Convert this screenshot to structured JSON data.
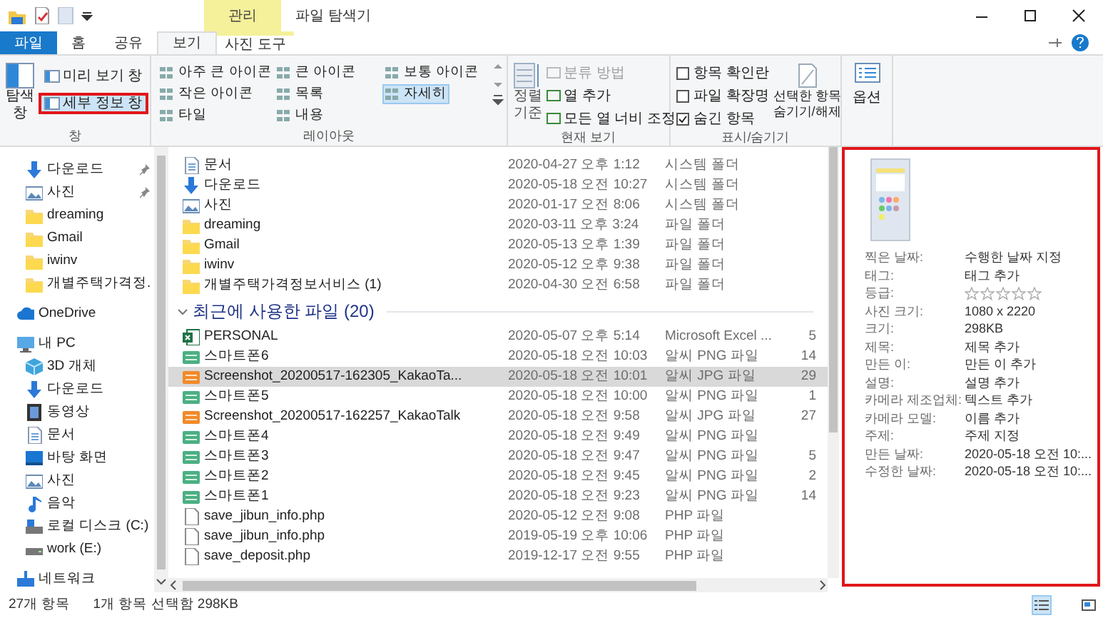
{
  "title_bar": {
    "context_tab": "관리",
    "title": "파일 탐색기"
  },
  "ribbon_tabs": [
    {
      "label": "파일",
      "kind": "file",
      "selected": false
    },
    {
      "label": "홈",
      "kind": "normal",
      "selected": false
    },
    {
      "label": "공유",
      "kind": "normal",
      "selected": false
    },
    {
      "label": "보기",
      "kind": "normal",
      "selected": true
    },
    {
      "label": "사진 도구",
      "kind": "context",
      "selected": false
    }
  ],
  "ribbon": {
    "pane_group": {
      "label": "창",
      "nav_button": [
        "탐색",
        "창"
      ],
      "buttons": [
        {
          "label": "미리 보기 창",
          "selected": false
        },
        {
          "label": "세부 정보 창",
          "selected": true
        }
      ]
    },
    "layout_group": {
      "label": "레이아웃",
      "items": [
        {
          "label": "아주 큰 아이콘",
          "selected": false
        },
        {
          "label": "큰 아이콘",
          "selected": false
        },
        {
          "label": "보통 아이콘",
          "selected": false
        },
        {
          "label": "작은 아이콘",
          "selected": false
        },
        {
          "label": "목록",
          "selected": false
        },
        {
          "label": "자세히",
          "selected": true
        },
        {
          "label": "타일",
          "selected": false
        },
        {
          "label": "내용",
          "selected": false
        }
      ]
    },
    "view_group": {
      "label": "현재 보기",
      "sort_button": [
        "정렬",
        "기준"
      ],
      "items": [
        {
          "label": "분류 방법",
          "disabled": true
        },
        {
          "label": "열 추가",
          "disabled": false
        },
        {
          "label": "모든 열 너비 조정",
          "disabled": false
        }
      ]
    },
    "show_group": {
      "label": "표시/숨기기",
      "checkboxes": [
        {
          "label": "항목 확인란",
          "checked": false
        },
        {
          "label": "파일 확장명",
          "checked": false
        },
        {
          "label": "숨긴 항목",
          "checked": true
        }
      ],
      "hide_button": [
        "선택한 항목",
        "숨기기/해제"
      ]
    },
    "options_button": "옵션"
  },
  "quick_access_items": [
    {
      "label": "다운로드",
      "kind": "download",
      "pinned": true
    },
    {
      "label": "사진",
      "kind": "pictures",
      "pinned": true
    },
    {
      "label": "dreaming",
      "kind": "folder",
      "pinned": false
    },
    {
      "label": "Gmail",
      "kind": "folder",
      "pinned": false
    },
    {
      "label": "iwinv",
      "kind": "folder",
      "pinned": false
    },
    {
      "label": "개별주택가격정.",
      "kind": "folder",
      "pinned": false
    }
  ],
  "nav_items": [
    {
      "label": "OneDrive",
      "kind": "cloud"
    },
    {
      "label": "내 PC",
      "kind": "pc",
      "children": [
        {
          "label": "3D 개체",
          "kind": "cube"
        },
        {
          "label": "다운로드",
          "kind": "download"
        },
        {
          "label": "동영상",
          "kind": "video"
        },
        {
          "label": "문서",
          "kind": "document"
        },
        {
          "label": "바탕 화면",
          "kind": "desktop"
        },
        {
          "label": "사진",
          "kind": "pictures"
        },
        {
          "label": "음악",
          "kind": "music"
        },
        {
          "label": "로컬 디스크 (C:)",
          "kind": "disk"
        },
        {
          "label": "work (E:)",
          "kind": "drive"
        }
      ]
    },
    {
      "label": "네트워크",
      "kind": "network"
    }
  ],
  "file_groups": [
    {
      "rows": [
        {
          "name": "문서",
          "kind": "document",
          "date": "2020-04-27 오후 1:12",
          "type": "시스템 폴더",
          "selected": false
        },
        {
          "name": "다운로드",
          "kind": "download",
          "date": "2020-05-18 오전 10:27",
          "type": "시스템 폴더",
          "selected": false
        },
        {
          "name": "사진",
          "kind": "pictures",
          "date": "2020-01-17 오전 8:06",
          "type": "시스템 폴더",
          "selected": false
        },
        {
          "name": "dreaming",
          "kind": "folder",
          "date": "2020-03-11 오후 3:24",
          "type": "파일 폴더",
          "selected": false
        },
        {
          "name": "Gmail",
          "kind": "folder",
          "date": "2020-05-13 오후 1:39",
          "type": "파일 폴더",
          "selected": false
        },
        {
          "name": "iwinv",
          "kind": "folder",
          "date": "2020-05-12 오후 9:38",
          "type": "파일 폴더",
          "selected": false
        },
        {
          "name": "개별주택가격정보서비스 (1)",
          "kind": "folder",
          "date": "2020-04-30 오전 6:58",
          "type": "파일 폴더",
          "selected": false
        }
      ]
    },
    {
      "header": "최근에 사용한 파일 (20)",
      "expanded": true,
      "rows": [
        {
          "name": "PERSONAL",
          "kind": "excel",
          "date": "2020-05-07 오후 5:14",
          "type": "Microsoft Excel ...",
          "size": "5",
          "selected": false
        },
        {
          "name": "스마트폰6",
          "kind": "png",
          "date": "2020-05-18 오전 10:03",
          "type": "알씨 PNG 파일",
          "size": "14",
          "selected": false
        },
        {
          "name": "Screenshot_20200517-162305_KakaoTa...",
          "kind": "jpg",
          "date": "2020-05-18 오전 10:01",
          "type": "알씨 JPG 파일",
          "size": "29",
          "selected": true
        },
        {
          "name": "스마트폰5",
          "kind": "png",
          "date": "2020-05-18 오전 10:00",
          "type": "알씨 PNG 파일",
          "size": "1",
          "selected": false
        },
        {
          "name": "Screenshot_20200517-162257_KakaoTalk",
          "kind": "jpg",
          "date": "2020-05-18 오전 9:58",
          "type": "알씨 JPG 파일",
          "size": "27",
          "selected": false
        },
        {
          "name": "스마트폰4",
          "kind": "png",
          "date": "2020-05-18 오전 9:49",
          "type": "알씨 PNG 파일",
          "selected": false
        },
        {
          "name": "스마트폰3",
          "kind": "png",
          "date": "2020-05-18 오전 9:47",
          "type": "알씨 PNG 파일",
          "size": "5",
          "selected": false
        },
        {
          "name": "스마트폰2",
          "kind": "png",
          "date": "2020-05-18 오전 9:45",
          "type": "알씨 PNG 파일",
          "size": "2",
          "selected": false
        },
        {
          "name": "스마트폰1",
          "kind": "png",
          "date": "2020-05-18 오전 9:23",
          "type": "알씨 PNG 파일",
          "size": "14",
          "selected": false
        },
        {
          "name": "save_jibun_info.php",
          "kind": "file",
          "date": "2020-05-12 오전 9:08",
          "type": "PHP 파일",
          "selected": false
        },
        {
          "name": "save_jibun_info.php",
          "kind": "file",
          "date": "2019-05-19 오후 10:06",
          "type": "PHP 파일",
          "selected": false
        },
        {
          "name": "save_deposit.php",
          "kind": "file",
          "date": "2019-12-17 오전 9:55",
          "type": "PHP 파일",
          "selected": false
        }
      ]
    }
  ],
  "details_pane": {
    "fields": [
      {
        "label": "찍은 날짜:",
        "value": "수행한 날짜 지정",
        "kind": "text"
      },
      {
        "label": "태그:",
        "value": "태그 추가",
        "kind": "text"
      },
      {
        "label": "등급:",
        "stars": 0,
        "kind": "rating"
      },
      {
        "label": "사진 크기:",
        "value": "1080 x 2220",
        "kind": "text"
      },
      {
        "label": "크기:",
        "value": "298KB",
        "kind": "text"
      },
      {
        "label": "제목:",
        "value": "제목 추가",
        "kind": "text"
      },
      {
        "label": "만든 이:",
        "value": "만든 이 추가",
        "kind": "text"
      },
      {
        "label": "설명:",
        "value": "설명 추가",
        "kind": "text"
      },
      {
        "label": "카메라 제조업체:",
        "value": "텍스트 추가",
        "kind": "text"
      },
      {
        "label": "카메라 모델:",
        "value": "이름 추가",
        "kind": "text"
      },
      {
        "label": "주제:",
        "value": "주제 지정",
        "kind": "text"
      },
      {
        "label": "만든 날짜:",
        "value": "2020-05-18 오전 10:...",
        "kind": "text"
      },
      {
        "label": "수정한 날짜:",
        "value": "2020-05-18 오전 10:...",
        "kind": "text"
      }
    ]
  },
  "view_toggles": [
    {
      "kind": "details",
      "selected": true
    },
    {
      "kind": "preview",
      "selected": false
    }
  ],
  "status_bar": {
    "item_count": "27개 항목",
    "selection": "1개 항목 선택함 298KB"
  }
}
